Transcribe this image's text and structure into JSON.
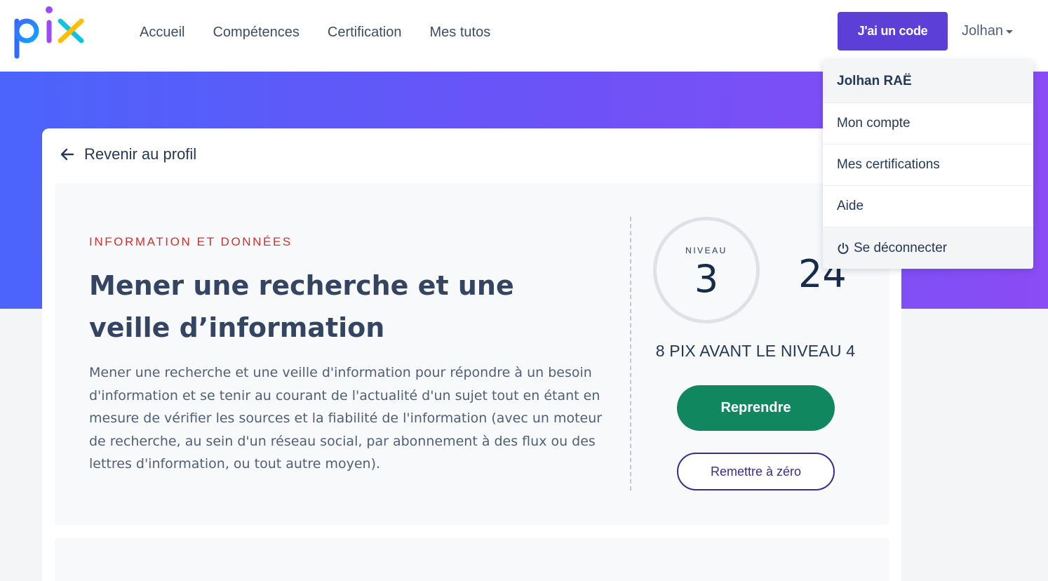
{
  "header": {
    "logo_text": "pix",
    "nav": [
      "Accueil",
      "Compétences",
      "Certification",
      "Mes tutos"
    ],
    "code_button": "J'ai un code",
    "user_name": "Jolhan"
  },
  "colors": {
    "brand_purple": "#5b3fd6",
    "hero_gradient_start": "#4b64fb",
    "hero_gradient_end": "#8a4cf5",
    "category_red": "#d0302f",
    "resume_green": "#10875e"
  },
  "back_link": "Revenir au profil",
  "competence": {
    "category": "INFORMATION ET DONNÉES",
    "title": "Mener une recherche et une veille d’information",
    "description": "Mener une recherche et une veille d'information pour répondre à un besoin d'information et se tenir au courant de l'actualité d'un sujet tout en étant en mesure de vérifier les sources et la fiabilité de l'information (avec un moteur de recherche, au sein d'un réseau social, par abonnement à des flux ou des lettres d'information, ou tout autre moyen)."
  },
  "level": {
    "label": "NIVEAU",
    "value": "3",
    "pix_score": "24",
    "next_level_text": "8 PIX AVANT LE NIVEAU 4"
  },
  "buttons": {
    "resume": "Reprendre",
    "reset": "Remettre à zéro"
  },
  "user_menu": {
    "full_name": "Jolhan RAË",
    "items": [
      "Mon compte",
      "Mes certifications",
      "Aide"
    ],
    "logout": "Se déconnecter"
  }
}
